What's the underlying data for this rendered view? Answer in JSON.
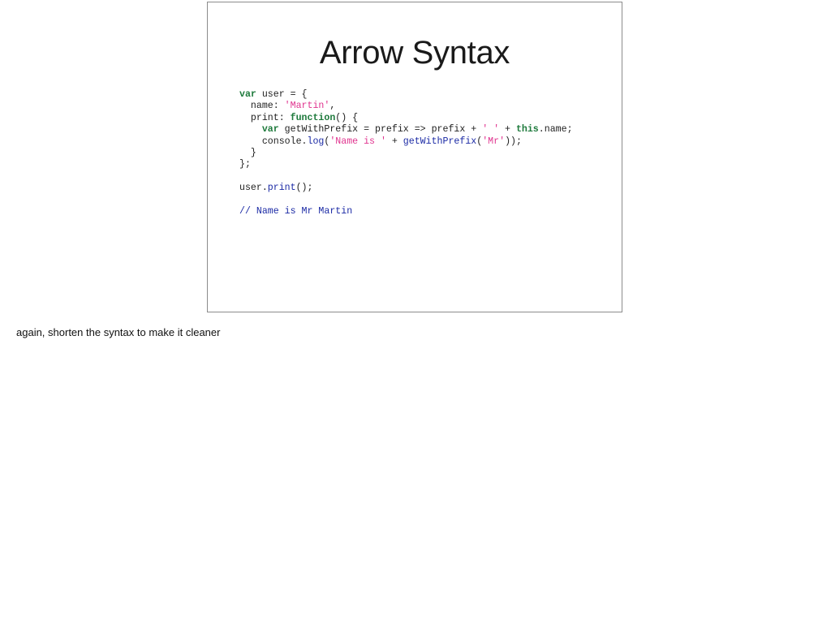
{
  "slide": {
    "title": "Arrow Syntax",
    "code_lines": [
      [
        {
          "text": "var",
          "kind": "keyword"
        },
        {
          "text": " user = {",
          "kind": "plain"
        }
      ],
      [
        {
          "text": "  name: ",
          "kind": "plain"
        },
        {
          "text": "'Martin'",
          "kind": "string"
        },
        {
          "text": ",",
          "kind": "plain"
        }
      ],
      [
        {
          "text": "  print: ",
          "kind": "plain"
        },
        {
          "text": "function",
          "kind": "keyword"
        },
        {
          "text": "() {",
          "kind": "plain"
        }
      ],
      [
        {
          "text": "    ",
          "kind": "plain"
        },
        {
          "text": "var",
          "kind": "keyword"
        },
        {
          "text": " getWithPrefix = prefix => prefix + ",
          "kind": "plain"
        },
        {
          "text": "' '",
          "kind": "string"
        },
        {
          "text": " + ",
          "kind": "plain"
        },
        {
          "text": "this",
          "kind": "keyword"
        },
        {
          "text": ".name;",
          "kind": "plain"
        }
      ],
      [
        {
          "text": "    console.",
          "kind": "plain"
        },
        {
          "text": "log",
          "kind": "function"
        },
        {
          "text": "(",
          "kind": "plain"
        },
        {
          "text": "'Name is '",
          "kind": "string"
        },
        {
          "text": " + ",
          "kind": "plain"
        },
        {
          "text": "getWithPrefix",
          "kind": "function"
        },
        {
          "text": "(",
          "kind": "plain"
        },
        {
          "text": "'Mr'",
          "kind": "string"
        },
        {
          "text": "));",
          "kind": "plain"
        }
      ],
      [
        {
          "text": "  }",
          "kind": "plain"
        }
      ],
      [
        {
          "text": "};",
          "kind": "plain"
        }
      ],
      [
        {
          "text": "",
          "kind": "plain"
        }
      ],
      [
        {
          "text": "user.",
          "kind": "plain"
        },
        {
          "text": "print",
          "kind": "function"
        },
        {
          "text": "();",
          "kind": "plain"
        }
      ],
      [
        {
          "text": "",
          "kind": "plain"
        }
      ],
      [
        {
          "text": "// Name is Mr Martin",
          "kind": "comment"
        }
      ]
    ]
  },
  "notes": {
    "text": "again, shorten the syntax to make it cleaner"
  },
  "colors": {
    "keyword": "#1e7a3c",
    "string": "#e0348f",
    "function": "#1b2aa5",
    "comment": "#1b2aa5",
    "border": "#8c8c8c"
  }
}
